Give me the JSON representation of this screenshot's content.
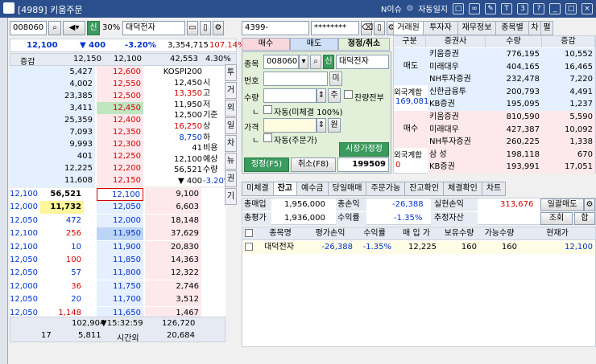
{
  "title": {
    "text": "[4989] 키움주문",
    "notice": "N이슈",
    "auto_log": "자동일지"
  },
  "left_top": {
    "code": "008060",
    "ratio": "30%",
    "name": "대덕전자",
    "sin": "신",
    "price": "12,100",
    "arrow_change": "▼   400",
    "change_pct": "-3.20%",
    "volume": "3,354,715",
    "vol_pct": "107.14%",
    "label_change": "증감",
    "ref_price1": "12,150",
    "ref_price2": "12,100",
    "ref_vol": "42,553",
    "ref_pct": "4.30%"
  },
  "ask_rows": [
    {
      "qty": "5,427",
      "price": "12,600"
    },
    {
      "qty": "4,002",
      "price": "12,550"
    },
    {
      "qty": "23,385",
      "price": "12,500"
    },
    {
      "qty": "3,411",
      "price": "12,450"
    },
    {
      "qty": "25,359",
      "price": "12,400"
    },
    {
      "qty": "7,093",
      "price": "12,350"
    },
    {
      "qty": "9,993",
      "price": "12,300"
    },
    {
      "qty": "401",
      "price": "12,250"
    },
    {
      "qty": "12,225",
      "price": "12,200"
    },
    {
      "qty": "11,608",
      "price": "12,150"
    }
  ],
  "info_rows": [
    {
      "v": "KOSPI200",
      "k": ""
    },
    {
      "v": "12,450",
      "k": "시"
    },
    {
      "v": "13,350",
      "k": "고"
    },
    {
      "v": "11,950",
      "k": "저"
    },
    {
      "v": "12,500",
      "k": "기준"
    },
    {
      "v": "16,250",
      "k": "상"
    },
    {
      "v": "8,750",
      "k": "하"
    },
    {
      "v": "41",
      "k": "비용"
    },
    {
      "v": "12,100",
      "k": "예상"
    },
    {
      "v": "56,521",
      "k": "수량"
    },
    {
      "v": "▼   400",
      "k": "-3.20%"
    }
  ],
  "bid_rows": [
    {
      "p": "12,100",
      "e": "56,521",
      "price": "12,100",
      "qty": "9,100"
    },
    {
      "p": "12,000",
      "e": "11,732",
      "price": "12,050",
      "qty": "6,603"
    },
    {
      "p": "12,050",
      "e": "472",
      "price": "12,000",
      "qty": "18,148"
    },
    {
      "p": "12,100",
      "e": "256",
      "price": "11,950",
      "qty": "37,629"
    },
    {
      "p": "12,100",
      "e": "10",
      "price": "11,900",
      "qty": "20,830"
    },
    {
      "p": "12,050",
      "e": "100",
      "price": "11,850",
      "qty": "14,363"
    },
    {
      "p": "12,050",
      "e": "57",
      "price": "11,800",
      "qty": "12,322"
    },
    {
      "p": "12,000",
      "e": "36",
      "price": "11,750",
      "qty": "2,746"
    },
    {
      "p": "12,050",
      "e": "20",
      "price": "11,700",
      "qty": "3,512"
    },
    {
      "p": "12,050",
      "e": "1,148",
      "price": "11,650",
      "qty": "1,467"
    }
  ],
  "bottom_left": {
    "ask_total": "102,904",
    "time": "15:32:59",
    "bid_total": "126,720",
    "extra_a": "17",
    "extra_b": "5,811",
    "after_hours": "시간외",
    "extra_c": "20,684"
  },
  "side_tabs": [
    "투",
    "거",
    "외",
    "일",
    "차",
    "뉴",
    "권",
    "기"
  ],
  "order": {
    "account": "4399-",
    "password": "********",
    "tabs": [
      "매수",
      "매도",
      "정정/취소"
    ],
    "label_code": "종목",
    "code": "008060",
    "sin": "신",
    "name": "대덕전자",
    "label_num": "번호",
    "mi_btn": "미",
    "label_qty": "수량",
    "ju_btn": "주",
    "remain_all": "잔량전부",
    "auto_unfilled": "자동(미체결 100%)",
    "label_price": "가격",
    "won_btn": "원",
    "auto_order": "자동(주문가)",
    "market_modify": "시장가정정",
    "modify_btn": "정정(F5)",
    "cancel_btn": "취소(F8)",
    "order_no": "199509",
    "dash1": "ㄴ",
    "dash2": "ㄴ"
  },
  "broker": {
    "tabs": [
      "거래원",
      "투자자",
      "재무정보",
      "종목별",
      "차",
      "펼"
    ],
    "headers": [
      "구분",
      "증권사",
      "수량",
      "증감"
    ],
    "sell_label": "매도",
    "buy_label": "매수",
    "foreign_label": "외국계합",
    "foreign_sell_val": "169,081",
    "foreign_buy_val": "0",
    "sells": [
      {
        "b": "키움증권",
        "q": "776,195",
        "d": "10,552"
      },
      {
        "b": "미래대우",
        "q": "404,165",
        "d": "16,465"
      },
      {
        "b": "NH투자증권",
        "q": "232,478",
        "d": "7,220"
      },
      {
        "b": "신한금융투",
        "q": "200,793",
        "d": "4,491"
      },
      {
        "b": "KB증권",
        "q": "195,095",
        "d": "1,237"
      }
    ],
    "buys": [
      {
        "b": "키움증권",
        "q": "810,590",
        "d": "5,590"
      },
      {
        "b": "미래대우",
        "q": "427,387",
        "d": "10,092"
      },
      {
        "b": "NH투자증권",
        "q": "260,225",
        "d": "1,338"
      },
      {
        "b": "삼 성",
        "q": "198,118",
        "d": "670"
      },
      {
        "b": "KB증권",
        "q": "193,991",
        "d": "17,051"
      }
    ]
  },
  "balance": {
    "tabs": [
      "미체결",
      "잔고",
      "예수금",
      "당일매매",
      "주문가능",
      "잔고확인",
      "체결확인",
      "차트"
    ],
    "total_buy_label": "총매입",
    "total_buy": "1,956,000",
    "total_pl_label": "총손익",
    "total_pl": "-26,388",
    "realized_label": "실현손익",
    "realized": "313,676",
    "daily_sell": "일괄매도",
    "total_eval_label": "총평가",
    "total_eval": "1,936,000",
    "yield_label": "수익률",
    "yield": "-1.35%",
    "est_asset_label": "추정자산",
    "query_btn": "조회",
    "sum_btn": "합",
    "columns": [
      "종목명",
      "평가손익",
      "수익률",
      "매 입 가",
      "보유수량",
      "가능수량",
      "현재가"
    ],
    "rows": [
      {
        "name": "대덕전자",
        "pl": "-26,388",
        "yield": "-1.35%",
        "buy": "12,225",
        "hold": "160",
        "avail": "160",
        "cur": "12,100"
      }
    ]
  }
}
